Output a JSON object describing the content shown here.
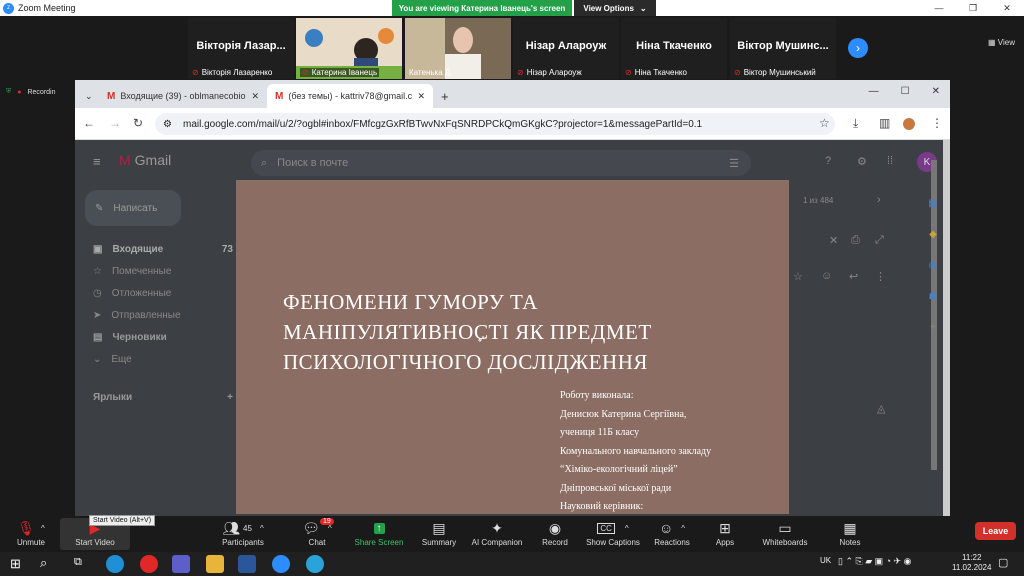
{
  "app": {
    "title": "Zoom Meeting"
  },
  "banner": {
    "text": "You are viewing Катерина Іванець's screen",
    "view_options": "View Options"
  },
  "window_controls": {
    "min": "—",
    "max": "❐",
    "close": "✕"
  },
  "participants": [
    {
      "big_name": "Вікторія  Лазар...",
      "name": "Вікторія Лазаренко",
      "video": false
    },
    {
      "big_name": "",
      "name": "Катерина Іванець",
      "video": true
    },
    {
      "big_name": "",
      "name": "Катенька Д.",
      "video": true
    },
    {
      "big_name": "Нізар  Алароуж",
      "name": "Нізар Алароуж",
      "video": false
    },
    {
      "big_name": "Ніна  Ткаченко",
      "name": "Ніна Ткаченко",
      "video": false
    },
    {
      "big_name": "Віктор  Мушинс...",
      "name": "Віктор Мушинський",
      "video": false
    }
  ],
  "view_label": "View",
  "recording_label": "Recordin",
  "browser": {
    "tabs": [
      {
        "title": "Входящие (39) - oblmanecobio..."
      },
      {
        "title": "(без темы) - kattriv78@gmail.co..."
      }
    ],
    "url": "mail.google.com/mail/u/2/?ogbl#inbox/FMfcgzGxRfBTwvNxFqSNRDPCkQmGKgkC?projector=1&messagePartId=0.1"
  },
  "gmail": {
    "logo": "Gmail",
    "search_placeholder": "Поиск в почте",
    "compose": "Написать",
    "sidebar": [
      {
        "label": "Входящие",
        "count": "73"
      },
      {
        "label": "Помеченные",
        "count": ""
      },
      {
        "label": "Отложенные",
        "count": ""
      },
      {
        "label": "Отправленные",
        "count": ""
      },
      {
        "label": "Черновики",
        "count": ""
      },
      {
        "label": "Еще",
        "count": ""
      }
    ],
    "labels_header": "Ярлыки",
    "pagination": "1 из 484",
    "avatar": "K"
  },
  "slide": {
    "title_lines": [
      "ФЕНОМЕНИ  ГУМОРУ ТА",
      "МАНІПУЛЯТИВНОСТІ ЯК  ПРЕДМЕТ",
      "ПСИХОЛОГІЧНОГО ДОСЛІДЖЕННЯ"
    ],
    "info_lines": [
      "Роботу виконала:",
      "Денисюк Катерина Сергіївна,",
      "учениця 11Б класу",
      "Комунального навчального закладу",
      "“Хіміко-екологічний ліцей”",
      "Дніпровської міської ради",
      "Науковий керівник:"
    ],
    "background": "#8b6d63"
  },
  "toolbar": {
    "items": [
      {
        "label": "Unmute",
        "icon": "mic-off"
      },
      {
        "label": "Start Video",
        "icon": "video-off"
      },
      {
        "label": "Participants",
        "icon": "people",
        "count": "45"
      },
      {
        "label": "Chat",
        "icon": "chat",
        "badge": "19"
      },
      {
        "label": "Share Screen",
        "icon": "share"
      },
      {
        "label": "Summary",
        "icon": "summary"
      },
      {
        "label": "AI Companion",
        "icon": "sparkle"
      },
      {
        "label": "Record",
        "icon": "record"
      },
      {
        "label": "Show Captions",
        "icon": "cc"
      },
      {
        "label": "Reactions",
        "icon": "emoji"
      },
      {
        "label": "Apps",
        "icon": "apps"
      },
      {
        "label": "Whiteboards",
        "icon": "whiteboard"
      },
      {
        "label": "Notes",
        "icon": "notes"
      }
    ],
    "tooltip": "Start Video (Alt+V)",
    "leave": "Leave",
    "share_color": "#24a148"
  },
  "taskbar": {
    "lang": "UK",
    "time": "11:22",
    "date": "11.02.2024"
  }
}
